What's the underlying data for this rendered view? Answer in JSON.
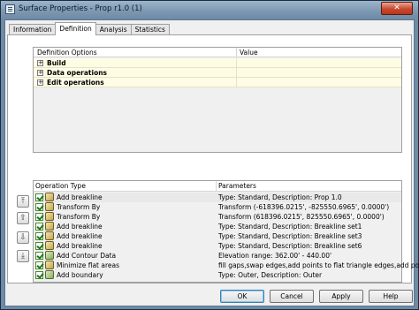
{
  "window": {
    "title": "Surface Properties - Prop r1.0 (1)",
    "close_label": "✕"
  },
  "tabs": [
    {
      "label": "Information",
      "active": false
    },
    {
      "label": "Definition",
      "active": true
    },
    {
      "label": "Analysis",
      "active": false
    },
    {
      "label": "Statistics",
      "active": false
    }
  ],
  "definition_grid": {
    "col_options": "Definition Options",
    "col_value": "Value",
    "rows": [
      {
        "expander": "+",
        "label": "Build",
        "value": ""
      },
      {
        "expander": "+",
        "label": "Data operations",
        "value": ""
      },
      {
        "expander": "+",
        "label": "Edit operations",
        "value": ""
      }
    ]
  },
  "side_buttons": [
    {
      "icon": "move-to-top-icon",
      "glyph": "⤒"
    },
    {
      "icon": "move-up-icon",
      "glyph": "⇧"
    },
    {
      "icon": "move-down-icon",
      "glyph": "⇩"
    },
    {
      "icon": "move-to-bottom-icon",
      "glyph": "⤓"
    }
  ],
  "operations_grid": {
    "col_type": "Operation Type",
    "col_params": "Parameters",
    "rows": [
      {
        "name": "Add breakline",
        "params": "Type: Standard, Description: Prop 1.0",
        "checked": true,
        "selected": true
      },
      {
        "name": "Transform By",
        "params": "Transform (-618396.0215', -825550.6965', 0.0000')",
        "checked": true,
        "selected": false
      },
      {
        "name": "Transform By",
        "params": "Transform (618396.0215', 825550.6965', 0.0000')",
        "checked": true,
        "selected": false
      },
      {
        "name": "Add breakline",
        "params": "Type: Standard, Description: Breakline set1",
        "checked": true,
        "selected": false
      },
      {
        "name": "Add breakline",
        "params": "Type: Standard, Description: Breakline set3",
        "checked": true,
        "selected": false
      },
      {
        "name": "Add breakline",
        "params": "Type: Standard, Description: Breakline set6",
        "checked": true,
        "selected": false
      },
      {
        "name": "Add Contour Data",
        "params": "Elevation range: 362.00' - 440.00'",
        "checked": true,
        "selected": false
      },
      {
        "name": "Minimize flat areas",
        "params": "fill gaps,swap edges,add points to flat triangle edges,add poin...",
        "checked": true,
        "selected": false
      },
      {
        "name": "Add boundary",
        "params": "Type: Outer, Description: Outer",
        "checked": true,
        "selected": false
      }
    ]
  },
  "buttons": {
    "ok": "OK",
    "cancel": "Cancel",
    "apply": "Apply",
    "help": "Help"
  }
}
